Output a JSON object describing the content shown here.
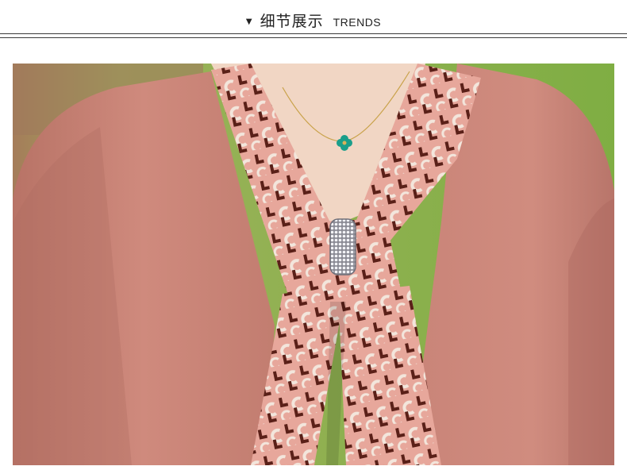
{
  "header": {
    "marker": "▼",
    "title_cn": "细节展示",
    "title_en": "TRENDS"
  },
  "photo": {
    "subject": "product-detail-photo",
    "colors": {
      "cardigan": "#c98478",
      "cardigan_shadow": "#a9655c",
      "scarf_base": "#e7a79b",
      "scarf_pattern_dark": "#5a2018",
      "scarf_pattern_light": "#f3e6dc",
      "background_grass": "#8bb24a",
      "background_wall": "#a0795b",
      "skin": "#f1d6c4",
      "pendant": "#1a9e8a"
    }
  }
}
